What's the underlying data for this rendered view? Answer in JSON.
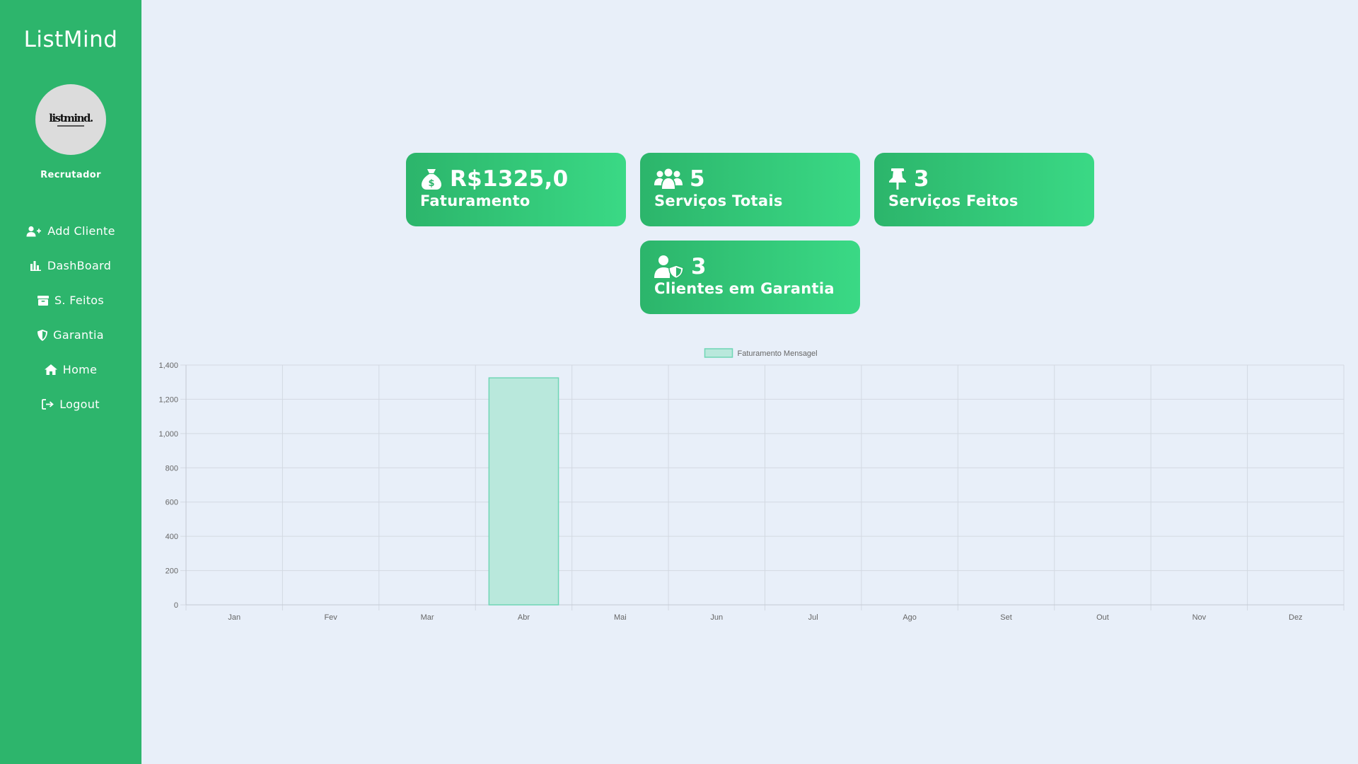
{
  "app": {
    "title": "ListMind",
    "avatar_text": "listmind.",
    "role": "Recrutador"
  },
  "nav": [
    {
      "label": "Add Cliente",
      "icon": "add-user-icon"
    },
    {
      "label": "DashBoard",
      "icon": "bar-chart-icon"
    },
    {
      "label": "S. Feitos",
      "icon": "archive-box-icon"
    },
    {
      "label": "Garantia",
      "icon": "shield-icon"
    },
    {
      "label": "Home",
      "icon": "home-icon"
    },
    {
      "label": "Logout",
      "icon": "logout-icon"
    }
  ],
  "cards": [
    {
      "value": "R$1325,0",
      "label": "Faturamento",
      "icon": "money-bag-icon"
    },
    {
      "value": "5",
      "label": "Serviços Totais",
      "icon": "users-group-icon"
    },
    {
      "value": "3",
      "label": "Serviços Feitos",
      "icon": "push-pin-icon"
    },
    {
      "value": "3",
      "label": "Clientes em Garantia",
      "icon": "user-shield-icon"
    }
  ],
  "colors": {
    "sidebar": "#2db56c",
    "card_start": "#2cb56b",
    "card_end": "#3ad985",
    "background": "#e8eff9",
    "bar_fill": "#b9e8dc",
    "bar_stroke": "#6fd6b5"
  },
  "chart_data": {
    "type": "bar",
    "categories": [
      "Jan",
      "Fev",
      "Mar",
      "Abr",
      "Mai",
      "Jun",
      "Jul",
      "Ago",
      "Set",
      "Out",
      "Nov",
      "Dez"
    ],
    "series": [
      {
        "name": "Faturamento Mensagel",
        "values": [
          0,
          0,
          0,
          1325,
          0,
          0,
          0,
          0,
          0,
          0,
          0,
          0
        ]
      }
    ],
    "yticks": [
      "0",
      "200",
      "400",
      "600",
      "800",
      "1,000",
      "1,200",
      "1,400"
    ],
    "ylim": [
      0,
      1400
    ],
    "grid": true,
    "legend": "top-center"
  }
}
